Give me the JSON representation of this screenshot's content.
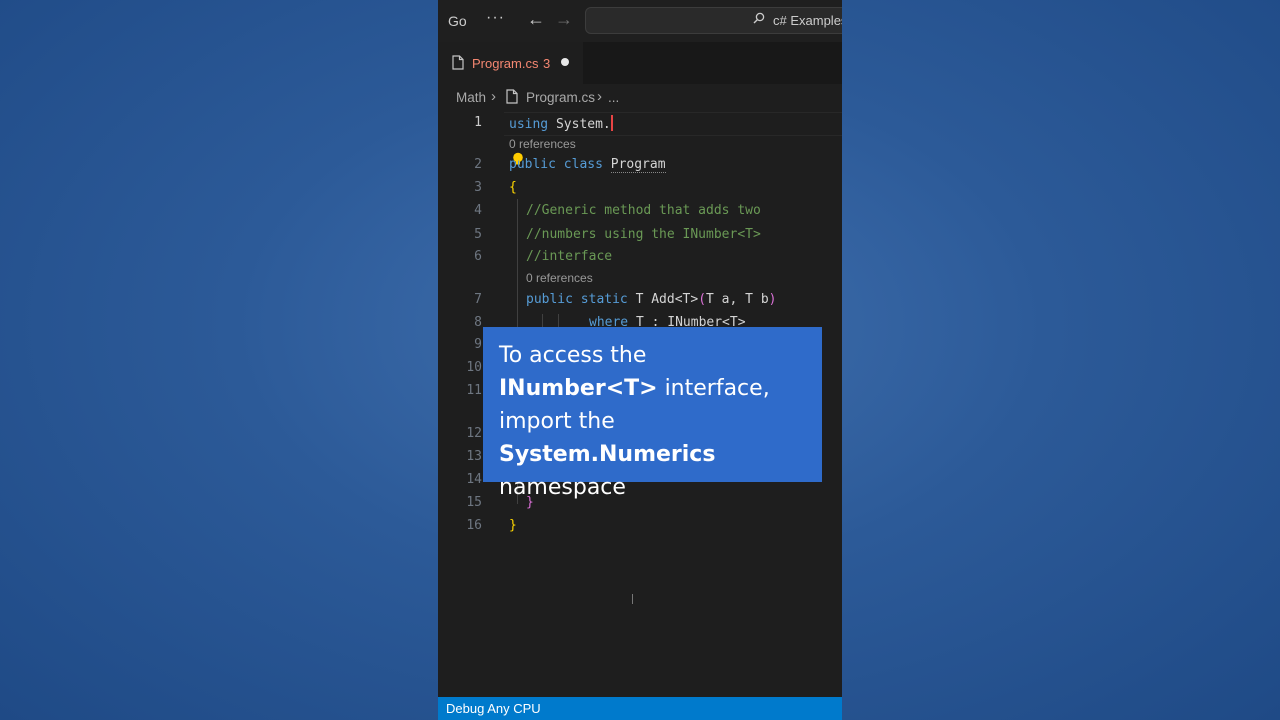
{
  "titlebar": {
    "menu_go": "Go",
    "more": "···",
    "back": "←",
    "forward": "→",
    "search_label": "c# Examples"
  },
  "tab": {
    "filename": "Program.cs",
    "problem_count": "3",
    "modified": true
  },
  "breadcrumb": {
    "folder": "Math",
    "file": "Program.cs",
    "ellipsis": "..."
  },
  "editor": {
    "code_lens": "0 references",
    "line_numbers": [
      "1",
      "2",
      "3",
      "4",
      "5",
      "6",
      "7",
      "8",
      "9",
      "10",
      "11",
      "12",
      "13",
      "14",
      "15",
      "16"
    ],
    "lines": {
      "l1_kw": "using",
      "l1_ns": " System.",
      "l2_kw": "public class ",
      "l2_type": "Program",
      "l3": "{",
      "l4": "//Generic method that adds two",
      "l5": "//numbers using the INumber<T>",
      "l6": "//interface",
      "l7_kw": "public static ",
      "l7_sig": "T Add<T>",
      "l7_paren_open": "(",
      "l7_params": "T a, T b",
      "l7_paren_close": ")",
      "l8_kw": "where",
      "l8_rest": " T : INumber<T>",
      "l15": "}",
      "l16": "}"
    }
  },
  "overlay": {
    "text1": "To access the ",
    "bold1": "INumber<T>",
    "text2": " interface, import the ",
    "bold2": "System.Numerics",
    "text3": " namespace"
  },
  "statusbar": {
    "label": "Debug Any CPU"
  },
  "colors": {
    "background": "#2c5a98",
    "editor_bg": "#1e1e1e",
    "status_bar": "#007acc",
    "overlay_bg": "#2f6bca",
    "tab_error": "#f48771"
  }
}
